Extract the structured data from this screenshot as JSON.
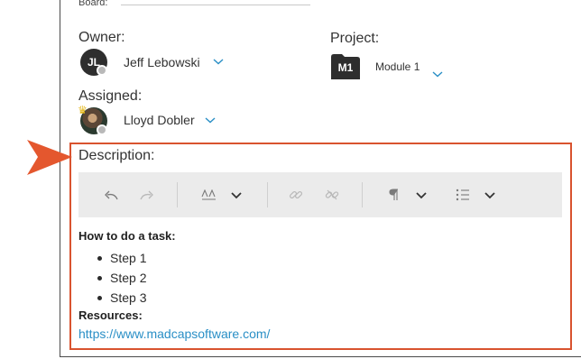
{
  "board": {
    "label": "Board:"
  },
  "owner": {
    "label": "Owner:",
    "initials": "JL",
    "name": "Jeff Lebowski"
  },
  "project": {
    "label": "Project:",
    "code": "M1",
    "name": "Module 1"
  },
  "assigned": {
    "label": "Assigned:",
    "name": "Lloyd Dobler"
  },
  "description": {
    "label": "Description:",
    "toolbar": [
      "undo-icon",
      "redo-icon",
      "font-size-icon",
      "chevron-down-icon",
      "link-icon",
      "unlink-icon",
      "paragraph-icon",
      "chevron-down-icon",
      "list-icon",
      "chevron-down-icon"
    ],
    "heading": "How to do a task:",
    "steps": [
      "Step 1",
      "Step 2",
      "Step 3"
    ],
    "resources_label": "Resources:",
    "link": "https://www.madcapsoftware.com/"
  },
  "colors": {
    "callout": "#e4572e",
    "highlight_border": "#d9532f",
    "accent": "#2a8fc6",
    "toolbar_bg": "#ebebeb"
  }
}
